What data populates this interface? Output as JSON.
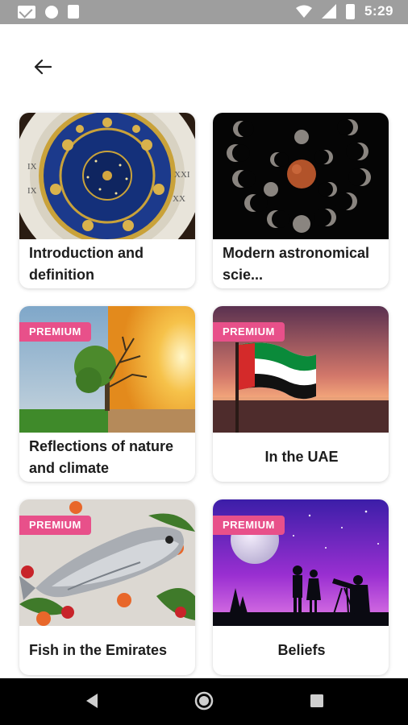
{
  "status_bar": {
    "time": "5:29",
    "icons": [
      "gmail-icon",
      "circle-notification-icon",
      "sd-card-icon",
      "wifi-icon",
      "signal-icon",
      "battery-icon"
    ]
  },
  "header": {
    "back_icon": "arrow-left-icon"
  },
  "colors": {
    "premium_badge": "#e8508a",
    "text": "#1c1c1c",
    "nav_bar": "#000000",
    "status_bar": "#9e9e9e"
  },
  "cards": [
    {
      "title": "Introduction and definition",
      "premium": false,
      "image": "zodiac-clock-image"
    },
    {
      "title": "Modern astronomical scie...",
      "premium": false,
      "image": "lunar-phases-image"
    },
    {
      "title": "Reflections of nature and climate",
      "premium": true,
      "badge": "PREMIUM",
      "image": "seasons-tree-image"
    },
    {
      "title": "In the UAE",
      "premium": true,
      "badge": "PREMIUM",
      "image": "uae-flag-sunset-image"
    },
    {
      "title": "Fish in the Emirates",
      "premium": true,
      "badge": "PREMIUM",
      "image": "fish-dish-image"
    },
    {
      "title": "Beliefs",
      "premium": true,
      "badge": "PREMIUM",
      "image": "stargazing-silhouette-image"
    }
  ],
  "nav_bar": {
    "icons": [
      "back-triangle-icon",
      "home-circle-icon",
      "recents-square-icon"
    ]
  }
}
